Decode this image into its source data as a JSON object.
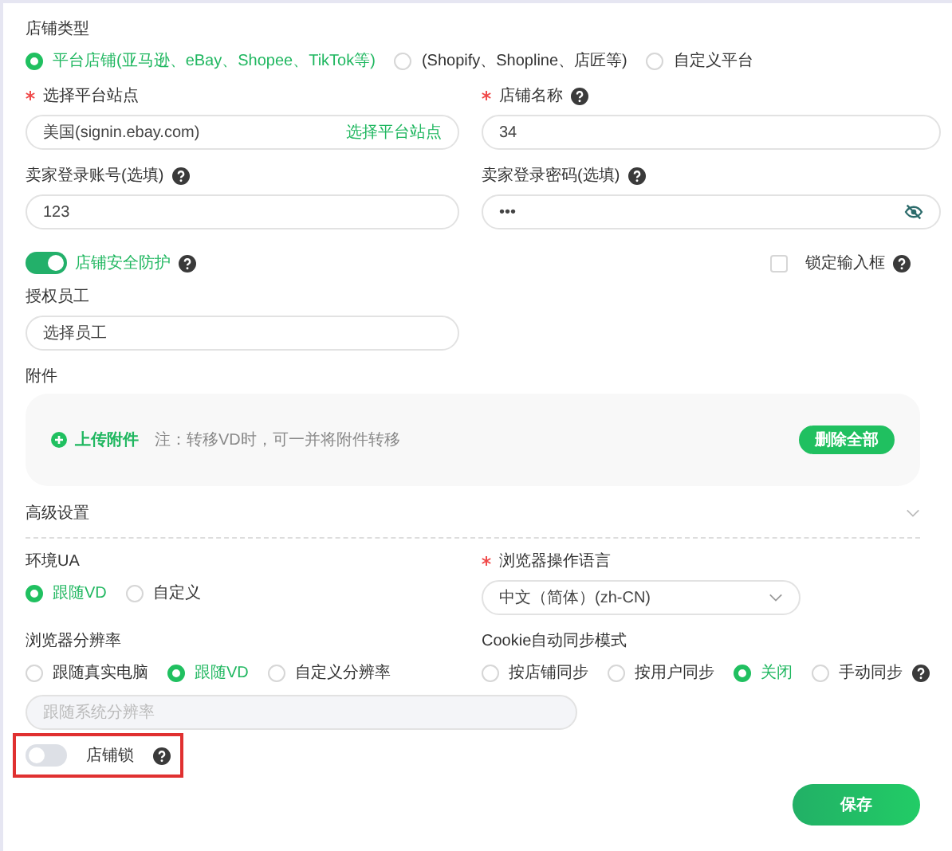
{
  "store_type": {
    "label": "店铺类型",
    "options": [
      {
        "label": "平台店铺(亚马逊、eBay、Shopee、TikTok等)",
        "selected": true
      },
      {
        "label": "(Shopify、Shopline、店匠等)",
        "selected": false
      },
      {
        "label": "自定义平台",
        "selected": false
      }
    ]
  },
  "platform_site": {
    "label": "选择平台站点",
    "required": true,
    "value": "美国(signin.ebay.com)",
    "action": "选择平台站点"
  },
  "store_name": {
    "label": "店铺名称",
    "required": true,
    "help": true,
    "value": "34"
  },
  "seller_account": {
    "label": "卖家登录账号(选填)",
    "help": true,
    "value": "123"
  },
  "seller_password": {
    "label": "卖家登录密码(选填)",
    "help": true,
    "value": "•••"
  },
  "security_protection": {
    "label": "店铺安全防护",
    "on": true,
    "help": true
  },
  "lock_input": {
    "label": "锁定输入框",
    "checked": false,
    "help": true
  },
  "staff": {
    "label": "授权员工",
    "value": "选择员工"
  },
  "attachments": {
    "label": "附件",
    "upload": "上传附件",
    "note": "注：转移VD时，可一并将附件转移",
    "delete_all": "删除全部"
  },
  "advanced": {
    "label": "高级设置"
  },
  "ua": {
    "label": "环境UA",
    "options": [
      {
        "label": "跟随VD",
        "selected": true
      },
      {
        "label": "自定义",
        "selected": false
      }
    ]
  },
  "language": {
    "label": "浏览器操作语言",
    "required": true,
    "value": "中文（简体）(zh-CN)"
  },
  "resolution": {
    "label": "浏览器分辨率",
    "options": [
      {
        "label": "跟随真实电脑",
        "selected": false
      },
      {
        "label": "跟随VD",
        "selected": true
      },
      {
        "label": "自定义分辨率",
        "selected": false
      }
    ],
    "placeholder": "跟随系统分辨率"
  },
  "cookie_sync": {
    "label": "Cookie自动同步模式",
    "options": [
      {
        "label": "按店铺同步",
        "selected": false
      },
      {
        "label": "按用户同步",
        "selected": false
      },
      {
        "label": "关闭",
        "selected": true
      },
      {
        "label": "手动同步",
        "selected": false,
        "help": true
      }
    ]
  },
  "store_lock": {
    "label": "店铺锁",
    "on": false,
    "help": true,
    "highlighted": true
  },
  "save": "保存"
}
